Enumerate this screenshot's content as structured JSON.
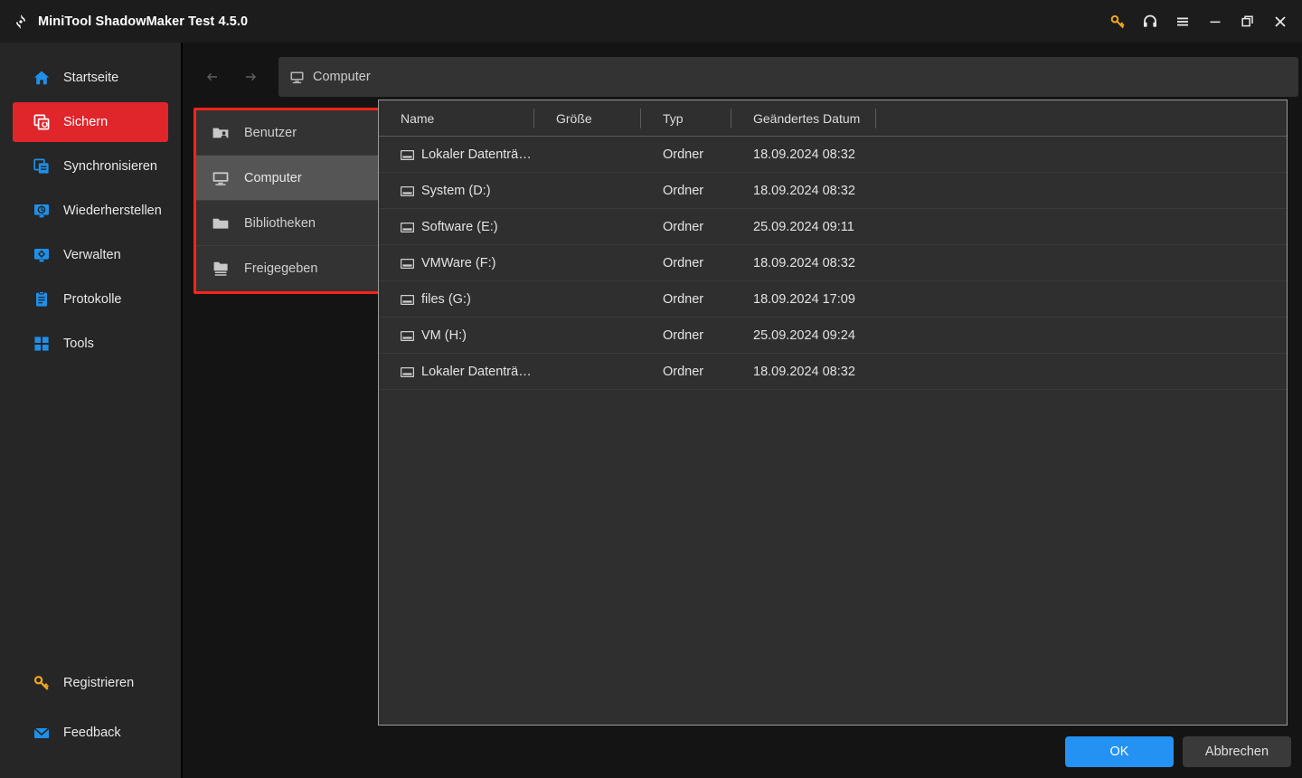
{
  "window": {
    "title": "MiniTool ShadowMaker Test 4.5.0",
    "logo_icon": "shadowmaker-logo-icon",
    "controls": [
      {
        "name": "key-icon",
        "label": "Register",
        "color": "#f0a81e"
      },
      {
        "name": "headset-icon",
        "label": "Support",
        "color": "#e8e8e8"
      },
      {
        "name": "hamburger-menu-icon",
        "label": "Menu",
        "color": "#e8e8e8"
      },
      {
        "name": "minimize-icon",
        "label": "Minimize",
        "color": "#e8e8e8"
      },
      {
        "name": "restore-icon",
        "label": "Restore",
        "color": "#e8e8e8"
      },
      {
        "name": "close-icon",
        "label": "Close",
        "color": "#e8e8e8"
      }
    ]
  },
  "sidebar": {
    "accent_active": "#e0252b",
    "items": [
      {
        "label": "Startseite",
        "icon": "home-icon",
        "active": false
      },
      {
        "label": "Sichern",
        "icon": "backup-icon",
        "active": true
      },
      {
        "label": "Synchronisieren",
        "icon": "sync-icon",
        "active": false
      },
      {
        "label": "Wiederherstellen",
        "icon": "restore-disk-icon",
        "active": false
      },
      {
        "label": "Verwalten",
        "icon": "manage-icon",
        "active": false
      },
      {
        "label": "Protokolle",
        "icon": "logs-icon",
        "active": false
      },
      {
        "label": "Tools",
        "icon": "tools-icon",
        "active": false
      }
    ],
    "bottom_items": [
      {
        "label": "Registrieren",
        "icon": "key-icon"
      },
      {
        "label": "Feedback",
        "icon": "mail-icon"
      }
    ]
  },
  "dialog": {
    "navbar": {
      "back_icon": "arrow-left-icon",
      "forward_icon": "arrow-right-icon",
      "path_icon": "computer-icon",
      "path_text": "Computer"
    },
    "tree": {
      "annotation_color": "#fc2318",
      "items": [
        {
          "label": "Benutzer",
          "icon": "user-folder-icon",
          "selected": false
        },
        {
          "label": "Computer",
          "icon": "computer-icon",
          "selected": true
        },
        {
          "label": "Bibliotheken",
          "icon": "folder-icon",
          "selected": false
        },
        {
          "label": "Freigegeben",
          "icon": "shared-folder-icon",
          "selected": false
        }
      ]
    },
    "filelist": {
      "columns": [
        "Name",
        "Größe",
        "Typ",
        "Geändertes Datum"
      ],
      "rows": [
        {
          "name": "Lokaler Datenträ…",
          "size": "",
          "type": "Ordner",
          "modified": "18.09.2024 08:32",
          "icon": "drive-icon"
        },
        {
          "name": "System (D:)",
          "size": "",
          "type": "Ordner",
          "modified": "18.09.2024 08:32",
          "icon": "drive-icon"
        },
        {
          "name": "Software (E:)",
          "size": "",
          "type": "Ordner",
          "modified": "25.09.2024 09:11",
          "icon": "drive-icon"
        },
        {
          "name": "VMWare (F:)",
          "size": "",
          "type": "Ordner",
          "modified": "18.09.2024 08:32",
          "icon": "drive-icon"
        },
        {
          "name": "files (G:)",
          "size": "",
          "type": "Ordner",
          "modified": "18.09.2024 17:09",
          "icon": "drive-icon"
        },
        {
          "name": "VM (H:)",
          "size": "",
          "type": "Ordner",
          "modified": "25.09.2024 09:24",
          "icon": "drive-icon"
        },
        {
          "name": "Lokaler Datenträ…",
          "size": "",
          "type": "Ordner",
          "modified": "18.09.2024 08:32",
          "icon": "drive-icon"
        }
      ]
    },
    "footer": {
      "ok_label": "OK",
      "cancel_label": "Abbrechen",
      "ok_color": "#2492f2"
    }
  }
}
